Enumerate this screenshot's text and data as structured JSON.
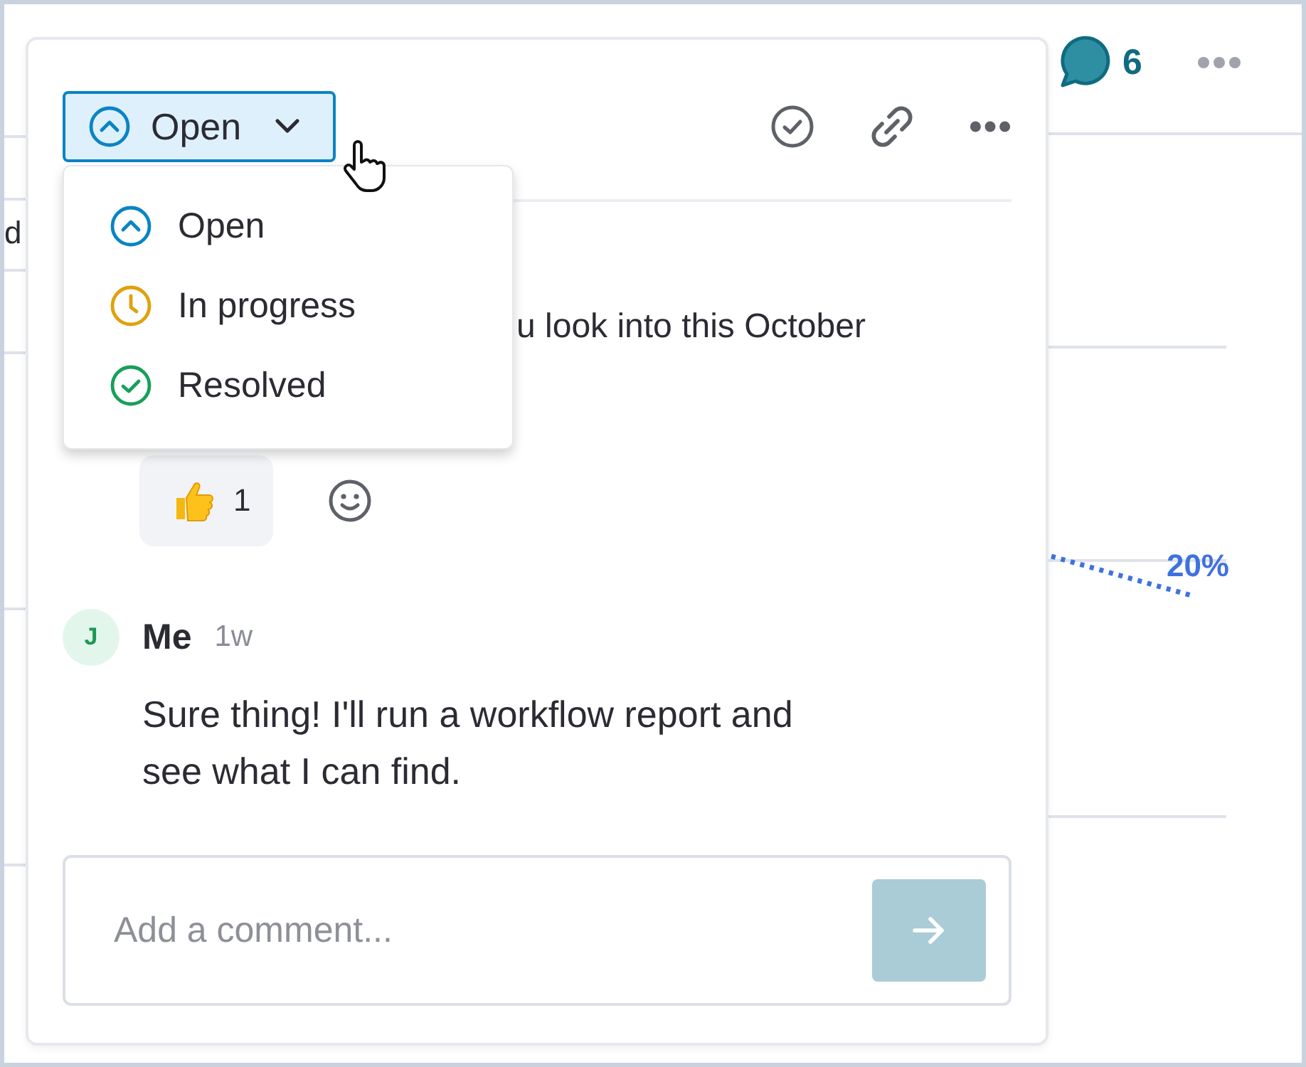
{
  "background": {
    "side_label": "d",
    "comment_count": "6",
    "chart_label": "20%"
  },
  "thread": {
    "status": {
      "label": "Open",
      "kind": "open",
      "menu_open": true
    },
    "status_menu": [
      {
        "label": "Open",
        "kind": "open"
      },
      {
        "label": "In progress",
        "kind": "progress"
      },
      {
        "label": "Resolved",
        "kind": "resolved"
      }
    ],
    "comments": [
      {
        "text": "u look into this October",
        "reactions": [
          {
            "count": "1"
          }
        ]
      },
      {
        "avatar": "J",
        "author": "Me",
        "time": "1w",
        "text": "Sure thing! I'll run a workflow report and see what I can find."
      }
    ],
    "composer": {
      "placeholder": "Add a comment..."
    }
  }
}
